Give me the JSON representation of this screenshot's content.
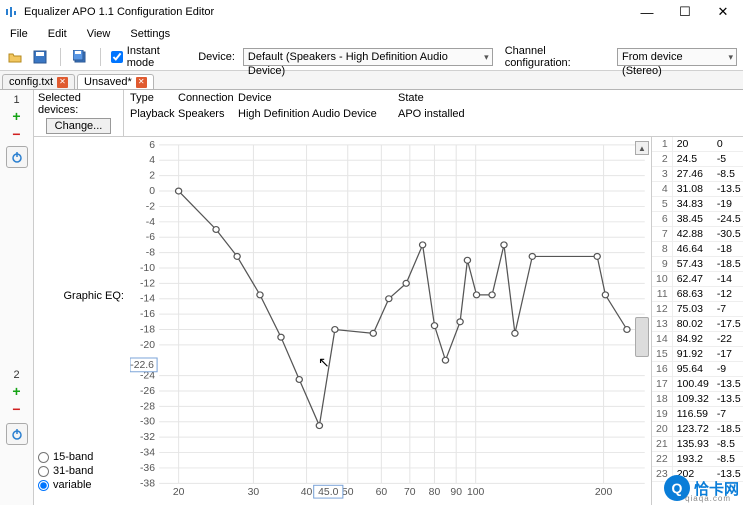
{
  "window": {
    "title": "Equalizer APO 1.1 Configuration Editor",
    "min": "—",
    "max": "☐",
    "close": "✕"
  },
  "menu": {
    "file": "File",
    "edit": "Edit",
    "view": "View",
    "settings": "Settings"
  },
  "toolbar": {
    "instant_label": "Instant mode",
    "device_label": "Device:",
    "device_combo": "Default (Speakers - High Definition Audio Device)",
    "chanconf_label": "Channel configuration:",
    "chanconf_combo": "From device (Stereo)"
  },
  "tabs": [
    {
      "label": "config.txt",
      "active": false
    },
    {
      "label": "Unsaved*",
      "active": true
    }
  ],
  "selected_devices": {
    "label": "Selected devices:",
    "change": "Change..."
  },
  "dev_table": {
    "head": {
      "type": "Type",
      "connection": "Connection",
      "device": "Device",
      "state": "State"
    },
    "row": {
      "type": "Playback",
      "connection": "Speakers",
      "device": "High Definition Audio Device",
      "state": "APO installed"
    }
  },
  "eq": {
    "label": "Graphic EQ:",
    "radios": {
      "b15": "15-band",
      "b31": "31-band",
      "var": "variable"
    },
    "y_badge": "-22.6",
    "x_badge": "45.0"
  },
  "chart_data": {
    "type": "line",
    "title": "",
    "xlabel": "",
    "ylabel": "",
    "xscale": "log",
    "ylim": [
      -38,
      6
    ],
    "series": [
      {
        "name": "EQ",
        "points": [
          {
            "x": 20,
            "y": 0
          },
          {
            "x": 24.5,
            "y": -5
          },
          {
            "x": 27.46,
            "y": -8.5
          },
          {
            "x": 31.08,
            "y": -13.5
          },
          {
            "x": 34.83,
            "y": -19
          },
          {
            "x": 38.45,
            "y": -24.5
          },
          {
            "x": 42.88,
            "y": -30.5
          },
          {
            "x": 46.64,
            "y": -18
          },
          {
            "x": 57.43,
            "y": -18.5
          },
          {
            "x": 62.47,
            "y": -14
          },
          {
            "x": 68.63,
            "y": -12
          },
          {
            "x": 75.03,
            "y": -7
          },
          {
            "x": 80.02,
            "y": -17.5
          },
          {
            "x": 84.92,
            "y": -22
          },
          {
            "x": 91.92,
            "y": -17
          },
          {
            "x": 95.64,
            "y": -9
          },
          {
            "x": 100.49,
            "y": -13.5
          },
          {
            "x": 109.32,
            "y": -13.5
          },
          {
            "x": 116.59,
            "y": -7
          },
          {
            "x": 123.72,
            "y": -18.5
          },
          {
            "x": 135.93,
            "y": -8.5
          },
          {
            "x": 193.2,
            "y": -8.5
          },
          {
            "x": 202,
            "y": -13.5
          },
          {
            "x": 227,
            "y": -18
          }
        ]
      }
    ],
    "yticks": [
      6,
      4,
      2,
      0,
      -2,
      -4,
      -6,
      -8,
      -10,
      -12,
      -14,
      -16,
      -18,
      -20,
      -24,
      -26,
      -28,
      -30,
      -32,
      -34,
      -36,
      -38
    ],
    "xticks": [
      20,
      30,
      40,
      50,
      60,
      70,
      80,
      90,
      100,
      200
    ]
  },
  "watermark": {
    "main": "恰卡网",
    "sub": "qiaqa.com",
    "glyph": "Q"
  }
}
